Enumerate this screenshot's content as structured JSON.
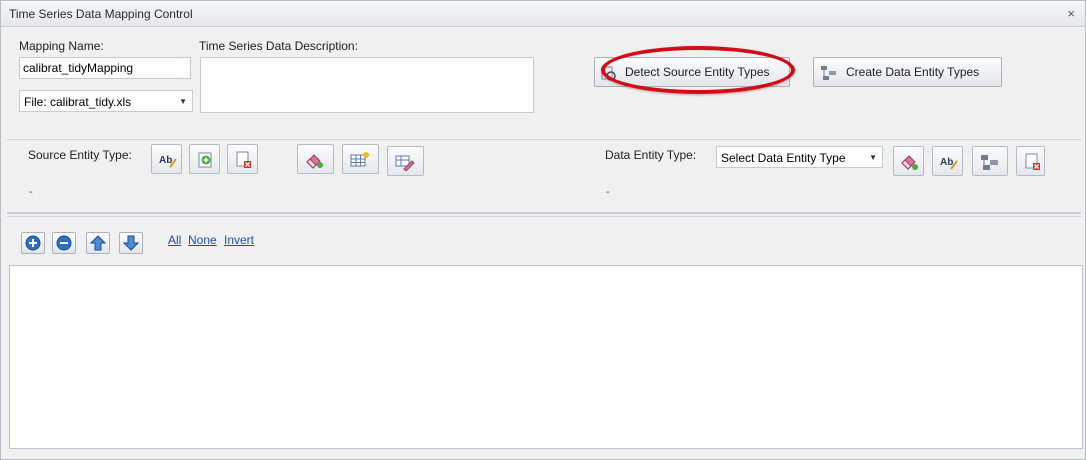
{
  "window": {
    "title": "Time Series Data Mapping Control",
    "close_glyph": "×"
  },
  "mapping": {
    "name_label": "Mapping Name:",
    "name_value": "calibrat_tidyMapping",
    "file_value": "File: calibrat_tidy.xls",
    "description_label": "Time Series Data Description:",
    "description_value": ""
  },
  "buttons": {
    "detect_source": "Detect Source Entity Types",
    "create_data": "Create Data Entity Types"
  },
  "source_entity": {
    "label": "Source Entity Type:",
    "value": "-"
  },
  "data_entity": {
    "label": "Data Entity Type:",
    "select_value": "Select Data Entity Type",
    "value": "-"
  },
  "selection_links": {
    "all": "All",
    "none": "None",
    "invert": "Invert"
  },
  "icons": {
    "window_close": "close-icon",
    "source_toolbar": [
      "rename-icon",
      "add-icon",
      "delete-icon",
      "eraser-icon",
      "table-icon",
      "table-edit-icon"
    ],
    "data_toolbar": [
      "eraser-icon",
      "rename-icon",
      "hierarchy-icon",
      "delete-icon"
    ],
    "list_toolbar": [
      "plus-circle-icon",
      "minus-circle-icon",
      "arrow-up-icon",
      "arrow-down-icon"
    ]
  },
  "colors": {
    "highlight": "#d10e17",
    "link": "#1f4fa8"
  }
}
